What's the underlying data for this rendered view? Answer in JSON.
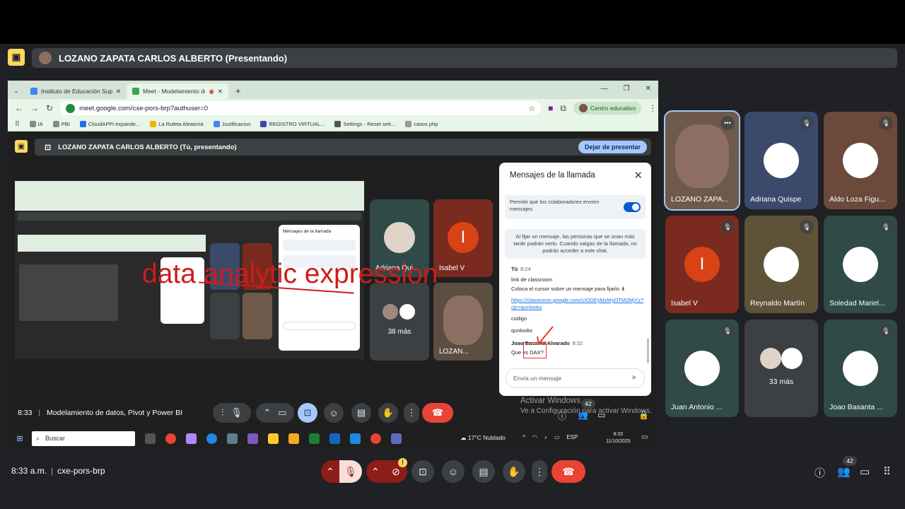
{
  "presenter_banner": "LOZANO ZAPATA CARLOS ALBERTO (Presentando)",
  "browser": {
    "tabs": [
      {
        "label": "Instituto de Educación Superior"
      },
      {
        "label": "Meet - Modelamiento de d"
      }
    ],
    "url": "meet.google.com/cxe-pors-brp?authuser=0",
    "profile": "Centro educativo",
    "bookmarks": [
      "IA",
      "PBI",
      "CloudAPPi expande...",
      "La Ruleta Aleatoria",
      "Justificacion",
      "REGISTRO VIRTUAL...",
      "Settings - Reset sett...",
      "casos php"
    ]
  },
  "inner_meet": {
    "banner": "LOZANO ZAPATA CARLOS ALBERTO (Tú, presentando)",
    "stop_button": "Dejar de presentar",
    "overlay_text": "data analytic expression",
    "tiles": [
      {
        "name": "Adriana Qui..."
      },
      {
        "name": "Isabel V",
        "initial": "I"
      },
      {
        "name": "38 más"
      },
      {
        "name": "LOZAN..."
      }
    ],
    "status": "8:33",
    "meeting_title": "Modelamiento de datos, Pivot y Power BI",
    "activate_windows": "Activar Windows",
    "activate_sub": "Ve a Configuración para activar Windows.",
    "people_count": "42"
  },
  "chat": {
    "title": "Mensajes de la llamada",
    "toggle_label": "Permitir que los colaboradores envíen mensajes",
    "pin_note": "Al fijar un mensaje, las personas que se unan más tarde podrán verlo. Cuando salgas de la llamada, no podrás acceder a este chat.",
    "messages": [
      {
        "sender": "Tú",
        "time": "8:24"
      },
      {
        "text": "link de classroom"
      },
      {
        "text": "Coloca el cursor sobre un mensaje para fijarlo"
      },
      {
        "link": "https://classroom.google.com/c/ODEyMzMyOTM2MjYz?cjc=qunlookx"
      },
      {
        "text": "codigo"
      },
      {
        "text": "qunlookx"
      },
      {
        "sender": "Joao Basanta Alvarado",
        "time": "8:32"
      },
      {
        "text": "Que es DAX?"
      }
    ],
    "input_placeholder": "Envía un mensaje"
  },
  "taskbar": {
    "search": "Buscar",
    "weather": "17°C  Nublado",
    "lang": "ESP",
    "time": "8:33",
    "date": "11/10/2025"
  },
  "participants": [
    {
      "name": "LOZANO ZAPA...",
      "color": "#6d5a4a"
    },
    {
      "name": "Adriana Quispe",
      "color": "#3b4a6b"
    },
    {
      "name": "Aldo Loza Figu...",
      "color": "#6b4a3b"
    },
    {
      "name": "Isabel V",
      "color": "#7b2a1f",
      "initial": "I"
    },
    {
      "name": "Reynaldo Martín",
      "color": "#5e5238"
    },
    {
      "name": "Soledad Mariel...",
      "color": "#2f4a47"
    },
    {
      "name": "Juan Antonio ...",
      "color": "#2f4a47"
    },
    {
      "name": "33 más",
      "color": "#3c4043"
    },
    {
      "name": "Joao Basanta ...",
      "color": "#2f4a47"
    }
  ],
  "bottom": {
    "time": "8:33 a.m.",
    "meeting_code": "cxe-pors-brp",
    "people_count": "42"
  }
}
